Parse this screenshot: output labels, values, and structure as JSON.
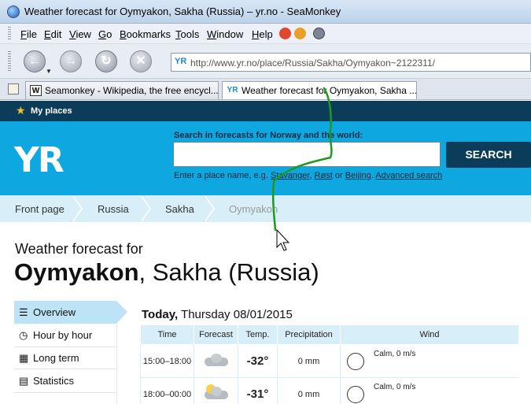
{
  "window": {
    "title": "Weather forecast for Oymyakon, Sakha (Russia) – yr.no - SeaMonkey"
  },
  "menu": [
    "File",
    "Edit",
    "View",
    "Go",
    "Bookmarks",
    "Tools",
    "Window",
    "Help"
  ],
  "address": {
    "url": "http://www.yr.no/place/Russia/Sakha/Oymyakon~2122311/",
    "site_icon": "YR"
  },
  "tabs": [
    {
      "label": "Seamonkey - Wikipedia, the free encycl...",
      "icon": "W"
    },
    {
      "label": "Weather forecast for Oymyakon, Sakha ...",
      "icon": "YR"
    }
  ],
  "site": {
    "my_places": "My places",
    "logo": "YR",
    "search": {
      "label": "Search in forecasts for Norway and the world:",
      "value": "",
      "button": "SEARCH",
      "hint_prefix": "Enter a place name, e.g.",
      "example1": "Stavanger",
      "example2": "Røst",
      "or": "or",
      "example3": "Beijing",
      "advanced": "Advanced search"
    },
    "breadcrumb": [
      "Front page",
      "Russia",
      "Sakha",
      "Oymyakon"
    ],
    "heading_small": "Weather forecast for",
    "heading_place": "Oymyakon",
    "heading_region": ", Sakha (Russia)",
    "sidebar": [
      "Overview",
      "Hour by hour",
      "Long term",
      "Statistics"
    ],
    "today_label": "Today,",
    "today_date": "Thursday 08/01/2015",
    "table_headers": [
      "Time",
      "Forecast",
      "Temp.",
      "Precipitation",
      "Wind"
    ],
    "rows": [
      {
        "time": "15:00–18:00",
        "forecast_icon": "cloudy-icon",
        "temp": "-32°",
        "precip": "0 mm",
        "wind": "Calm, 0 m/s"
      },
      {
        "time": "18:00–00:00",
        "forecast_icon": "partly-cloudy-icon",
        "temp": "-31°",
        "precip": "0 mm",
        "wind": "Calm, 0 m/s"
      }
    ]
  },
  "colors": {
    "header_blue": "#0fa7e0",
    "dark_navy": "#0b3c59",
    "light_blue": "#d8eef8",
    "annotation_green": "#1f9a1f"
  }
}
